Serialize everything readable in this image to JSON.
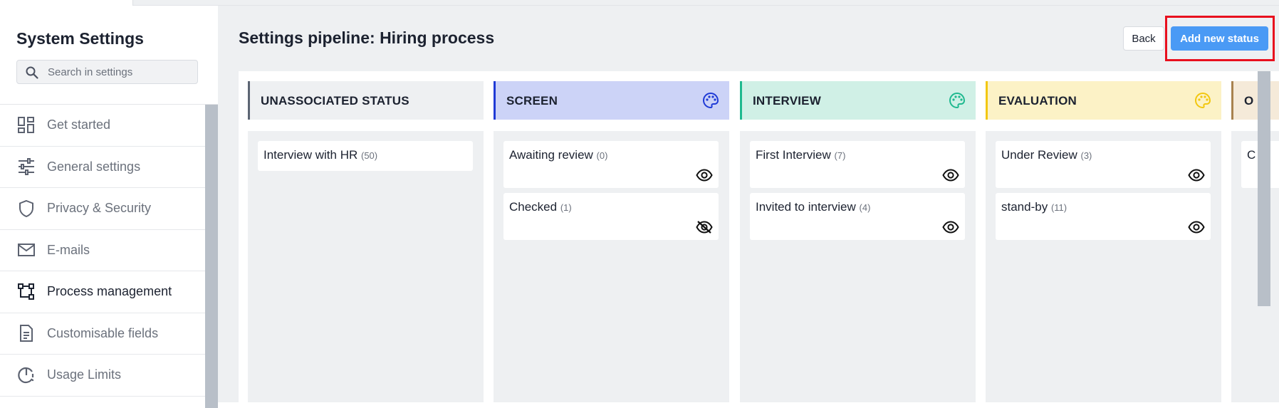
{
  "sidebar": {
    "title": "System Settings",
    "search_placeholder": "Search in settings",
    "items": [
      {
        "label": "Get started",
        "icon": "grid-icon"
      },
      {
        "label": "General settings",
        "icon": "sliders-icon"
      },
      {
        "label": "Privacy & Security",
        "icon": "shield-icon"
      },
      {
        "label": "E-mails",
        "icon": "mail-icon"
      },
      {
        "label": "Process management",
        "icon": "process-icon",
        "active": true
      },
      {
        "label": "Customisable fields",
        "icon": "document-icon"
      },
      {
        "label": "Usage Limits",
        "icon": "usage-gauge-icon"
      }
    ]
  },
  "header": {
    "title": "Settings pipeline: Hiring process",
    "back_label": "Back",
    "add_label": "Add new status"
  },
  "columns": [
    {
      "title": "UNASSOCIATED STATUS",
      "accent": "#5c6573",
      "head_bg": "#eef0f2",
      "palette": false,
      "cards": [
        {
          "label": "Interview with HR",
          "count": "(50)",
          "eye": "none"
        }
      ]
    },
    {
      "title": "SCREEN",
      "accent": "#1f3ad6",
      "head_bg": "#ccd3f7",
      "palette": true,
      "palette_color": "#1f3ad6",
      "cards": [
        {
          "label": "Awaiting review",
          "count": "(0)",
          "eye": "visible"
        },
        {
          "label": "Checked",
          "count": "(1)",
          "eye": "hidden"
        }
      ]
    },
    {
      "title": "INTERVIEW",
      "accent": "#1fb98f",
      "head_bg": "#d0f0e6",
      "palette": true,
      "palette_color": "#1fb98f",
      "cards": [
        {
          "label": "First Interview",
          "count": "(7)",
          "eye": "visible"
        },
        {
          "label": "Invited to interview",
          "count": "(4)",
          "eye": "visible"
        }
      ]
    },
    {
      "title": "EVALUATION",
      "accent": "#f2c70f",
      "head_bg": "#fcf2c6",
      "palette": true,
      "palette_color": "#f2c70f",
      "cards": [
        {
          "label": "Under Review",
          "count": "(3)",
          "eye": "visible"
        },
        {
          "label": "stand-by",
          "count": "(11)",
          "eye": "visible"
        }
      ]
    },
    {
      "title": "O",
      "accent": "#a8824f",
      "head_bg": "#f5ead9",
      "palette": false,
      "cards": [
        {
          "label": "C",
          "count": "",
          "eye": "none"
        }
      ]
    }
  ],
  "colors": {
    "primary": "#4a9af5",
    "highlight": "#e8101e"
  }
}
